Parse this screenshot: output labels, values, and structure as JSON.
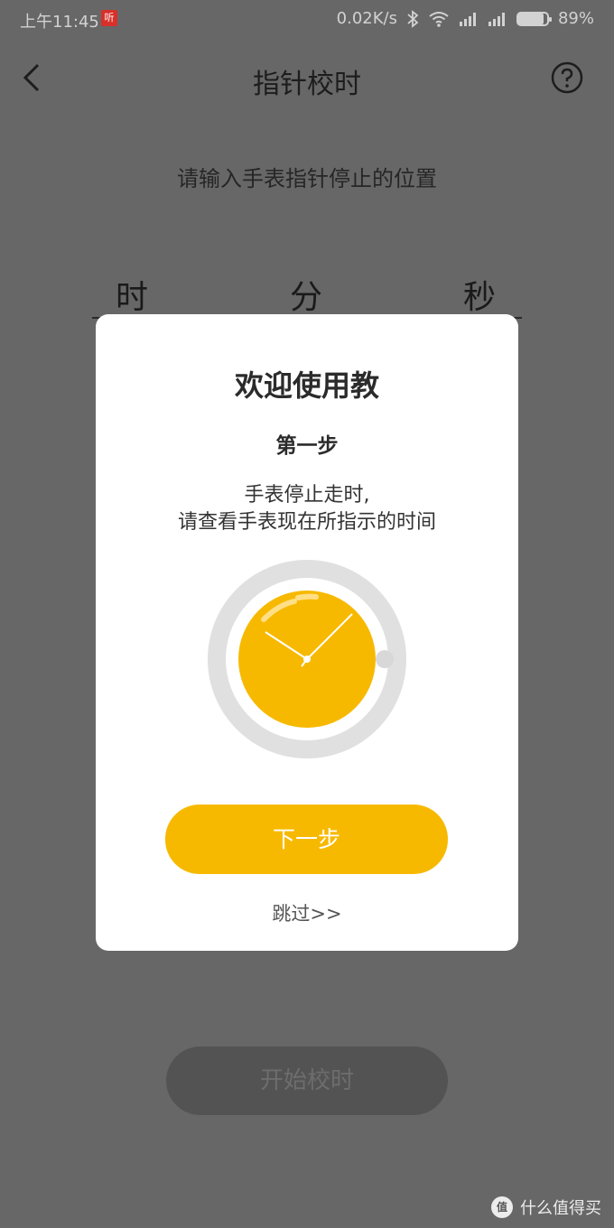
{
  "status_bar": {
    "time": "上午11:45",
    "app_badge": "听",
    "network_speed": "0.02K/s",
    "battery": "89%",
    "battery_level": 0.89,
    "icons": [
      "bluetooth-icon",
      "wifi-icon",
      "signal-icon",
      "signal-icon",
      "battery-icon"
    ]
  },
  "header": {
    "title": "指针校时",
    "back_icon": "chevron-left-icon",
    "help_icon": "help-circle-icon"
  },
  "main": {
    "prompt": "请输入手表指针停止的位置",
    "time_fields": [
      {
        "label": "时"
      },
      {
        "label": "分"
      },
      {
        "label": "秒"
      }
    ],
    "start_button": "开始校时"
  },
  "tutorial_modal": {
    "title": "欢迎使用教",
    "step": "第一步",
    "description_line1": "手表停止走时,",
    "description_line2": "请查看手表现在所指示的时间",
    "next_button": "下一步",
    "skip_link": "跳过>>"
  },
  "watermark": {
    "badge": "值",
    "text": "什么值得买"
  },
  "colors": {
    "accent": "#f7b900",
    "overlay": "#676767",
    "modal": "#ffffff"
  }
}
